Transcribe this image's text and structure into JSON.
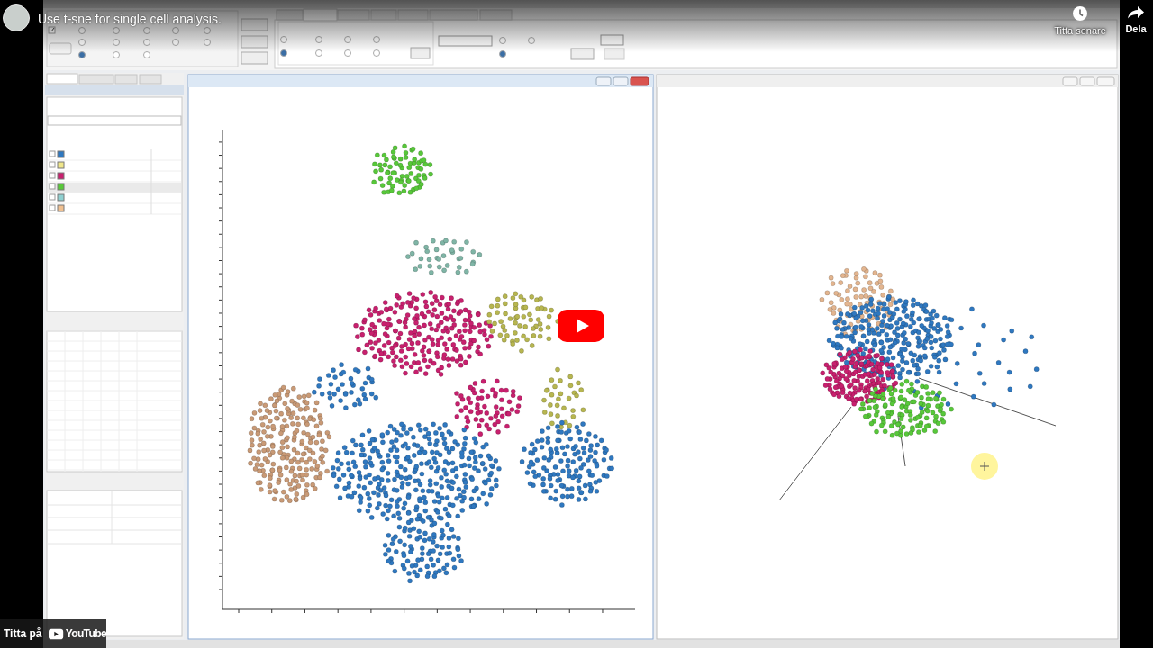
{
  "player": {
    "title": "Use t-sne for single cell analysis.",
    "actions": [
      {
        "kind": "watch_later",
        "label": "Titta senare"
      },
      {
        "kind": "share",
        "label": "Dela"
      }
    ],
    "watch_on": {
      "label": "Titta på",
      "logo_text": "YouTube"
    }
  }
}
